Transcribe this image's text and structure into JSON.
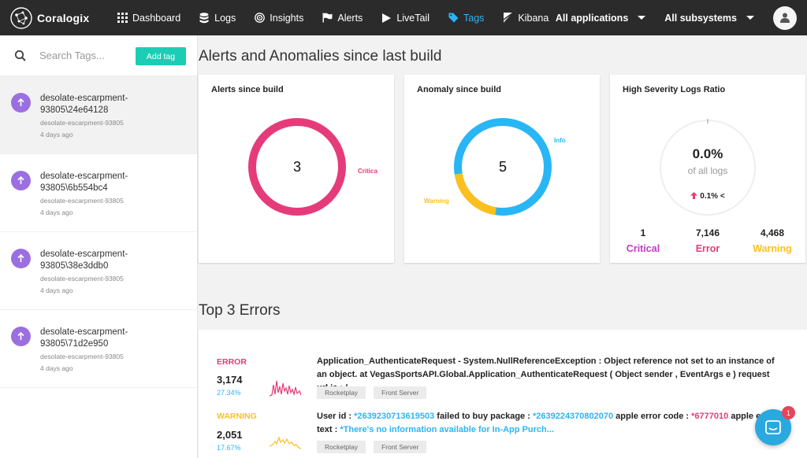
{
  "brand": {
    "name": "Coralogix"
  },
  "nav": {
    "items": [
      {
        "label": "Dashboard",
        "icon": "grid-icon"
      },
      {
        "label": "Logs",
        "icon": "database-icon"
      },
      {
        "label": "Insights",
        "icon": "target-icon"
      },
      {
        "label": "Alerts",
        "icon": "flag-icon"
      },
      {
        "label": "LiveTail",
        "icon": "play-icon"
      },
      {
        "label": "Tags",
        "icon": "tag-icon",
        "active": true
      },
      {
        "label": "Kibana",
        "icon": "kibana-icon"
      }
    ],
    "applications": "All applications",
    "subsystems": "All subsystems"
  },
  "sidebar": {
    "search_placeholder": "Search Tags...",
    "add_tag": "Add tag",
    "tags": [
      {
        "line1": "desolate-escarpment-",
        "line2": "93805\\24e64128",
        "sub": "desolate-escarpment-93805",
        "age": "4 days ago"
      },
      {
        "line1": "desolate-escarpment-",
        "line2": "93805\\6b554bc4",
        "sub": "desolate-escarpment-93805",
        "age": "4 days ago"
      },
      {
        "line1": "desolate-escarpment-",
        "line2": "93805\\38e3ddb0",
        "sub": "desolate-escarpment-93805",
        "age": "4 days ago"
      },
      {
        "line1": "desolate-escarpment-",
        "line2": "93805\\71d2e950",
        "sub": "desolate-escarpment-93805",
        "age": "4 days ago"
      }
    ]
  },
  "alerts_section": {
    "title": "Alerts and Anomalies since last build",
    "alerts_card": {
      "title": "Alerts since build",
      "total": "3",
      "segments": [
        {
          "label": "Critica",
          "value": 3,
          "color": "#e63b7a"
        }
      ]
    },
    "anomaly_card": {
      "title": "Anomaly since build",
      "total": "5",
      "segments": [
        {
          "label": "Info",
          "value": 4,
          "color": "#29b6f6"
        },
        {
          "label": "Warning",
          "value": 1,
          "color": "#fcc01e"
        }
      ]
    },
    "severity_card": {
      "title": "High Severity Logs Ratio",
      "ratio": "0.0%",
      "ratio_sub": "of all logs",
      "trend": "0.1% <",
      "stats": [
        {
          "value": "1",
          "label": "Critical",
          "color": "#c238c8"
        },
        {
          "value": "7,146",
          "label": "Error",
          "color": "#e63b7a"
        },
        {
          "value": "4,468",
          "label": "Warning",
          "color": "#fcc01e"
        }
      ]
    }
  },
  "errors_section": {
    "title": "Top 3 Errors",
    "rows": [
      {
        "level": "ERROR",
        "level_color": "#e63b7a",
        "count": "3,174",
        "percent": "27.34%",
        "spark_color": "#e63b7a",
        "message_parts": [
          {
            "text": "Application_AuthenticateRequest - System.NullReferenceException : Object reference not set to an instance of an object. at VegasSportsAPI.Global.Application_AuthenticateRequest ( Object sender , EventArgs e ) request url is : /",
            "style": ""
          }
        ],
        "chips": [
          "Rocketplay",
          "Front Server"
        ]
      },
      {
        "level": "WARNING",
        "level_color": "#fcc01e",
        "count": "2,051",
        "percent": "17.67%",
        "spark_color": "#fcc01e",
        "message_parts": [
          {
            "text": "User id : ",
            "style": ""
          },
          {
            "text": "*2639230713619503",
            "style": "blue"
          },
          {
            "text": " failed to buy package : ",
            "style": ""
          },
          {
            "text": "*2639224370802070",
            "style": "blue"
          },
          {
            "text": " apple error code : ",
            "style": ""
          },
          {
            "text": "*6777010",
            "style": "pink"
          },
          {
            "text": " apple e",
            "style": ""
          },
          {
            "text": "text : ",
            "style": ""
          },
          {
            "text": "*There's no information available for In-App Purch...",
            "style": "blue"
          }
        ],
        "chips": [
          "Rocketplay",
          "Front Server"
        ]
      }
    ]
  },
  "chat": {
    "badge": "1"
  }
}
